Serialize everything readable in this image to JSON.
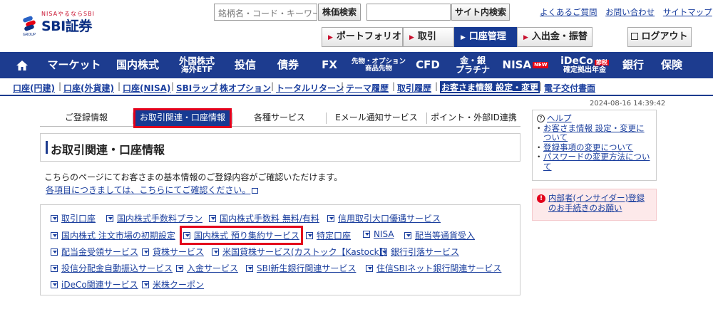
{
  "brand": {
    "tagline": "NISAやるならSBI",
    "name": "SBI証券",
    "group": "GROUP"
  },
  "header": {
    "stock_search_placeholder": "銘柄名・コード・キーワード",
    "stock_search_button": "株価検索",
    "site_search_placeholder": "",
    "site_search_button": "サイト内検索",
    "links": [
      "よくあるご質問",
      "お問い合わせ",
      "サイトマップ"
    ],
    "tabs": [
      "ポートフォリオ",
      "取引",
      "口座管理",
      "入出金・振替"
    ],
    "active_tab": "口座管理",
    "logout": "ログアウト"
  },
  "main_nav": [
    {
      "line1": "マーケット"
    },
    {
      "line1": "国内株式"
    },
    {
      "line1": "外国株式",
      "line2": "海外ETF"
    },
    {
      "line1": "投信"
    },
    {
      "line1": "債券"
    },
    {
      "line1": "FX"
    },
    {
      "line1": "先物・オプション",
      "line2": "商品先物"
    },
    {
      "line1": "CFD"
    },
    {
      "line1": "金・銀",
      "line2": "プラチナ"
    },
    {
      "line1": "NISA",
      "badge": "NEW"
    },
    {
      "line1": "iDeCo",
      "badge": "節税",
      "line2": "確定拠出年金"
    },
    {
      "line1": "銀行"
    },
    {
      "line1": "保険"
    }
  ],
  "sub_nav": [
    "口座(円建)",
    "口座(外貨建)",
    "口座(NISA)",
    "SBIラップ",
    "株オプション",
    "トータルリターン",
    "テーマ履歴",
    "取引履歴",
    "お客さま情報 設定・変更",
    "電子交付書面"
  ],
  "sub_nav_active": "お客さま情報 設定・変更",
  "timestamp": "2024-08-16 14:39:42",
  "sub_tabs": [
    "ご登録情報",
    "お取引関連・口座情報",
    "各種サービス",
    "Eメール通知サービス",
    "ポイント・外部ID連携"
  ],
  "page_title": "お取引関連・口座情報",
  "intro_text": "こちらのページにてお客さまの基本情報のご登録内容がご確認いただけます。",
  "intro_link": "各項目につきましては、こちらにてご確認ください。",
  "service_links": [
    [
      "取引口座",
      "国内株式手数料プラン",
      "国内株式手数料 無料/有料",
      "信用取引大口優遇サービス"
    ],
    [
      "国内株式 注文市場の初期設定",
      "国内株式 預り集約サービス",
      "特定口座",
      "NISA",
      "配当等通貨受入"
    ],
    [
      "配当金受領サービス",
      "貸株サービス",
      "米国貸株サービス(カストック【Kastock】)",
      "銀行引落サービス"
    ],
    [
      "投信分配金自動振込サービス",
      "入金サービス",
      "SBI新生銀行関連サービス",
      "住信SBIネット銀行関連サービス"
    ],
    [
      "iDeCo関連サービス",
      "米株クーポン"
    ]
  ],
  "help": {
    "title": "ヘルプ",
    "items": [
      "お客さま情報 設定・変更について",
      "登録事項の変更について",
      "パスワードの変更方法について"
    ]
  },
  "insider": {
    "text": "内部者(インサイダー)登録のお手続きのお願い"
  },
  "colors": {
    "nav_blue": "#1d3c8f",
    "highlight_red": "#e3001b",
    "brand_red": "#c8102e"
  }
}
